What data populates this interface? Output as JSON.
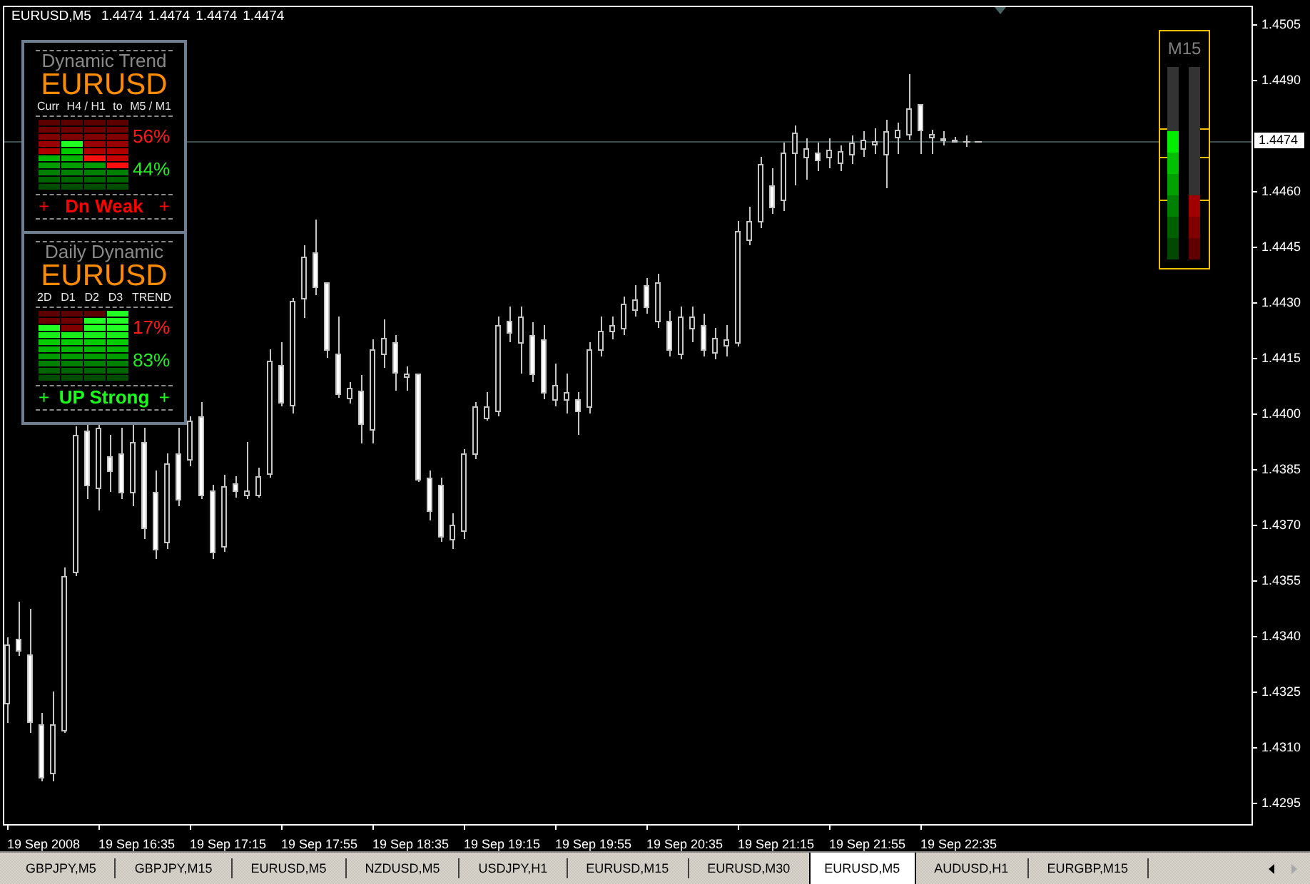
{
  "chart": {
    "symbol": "EURUSD,M5",
    "ohlc": [
      "1.4474",
      "1.4474",
      "1.4474",
      "1.4474"
    ]
  },
  "indicator_panels": [
    {
      "title": "Dynamic Trend",
      "symbol": "EURUSD",
      "column_labels": [
        "Curr",
        "H4 / H1",
        "to",
        "M5 / M1"
      ],
      "columns": [
        {
          "cells": [
            {
              "color": "#5c0000"
            },
            {
              "color": "#6e0000"
            },
            {
              "color": "#800000"
            },
            {
              "color": "#990000"
            },
            {
              "color": "#b00000"
            },
            {
              "color": "#00b400"
            },
            {
              "color": "#009c00"
            },
            {
              "color": "#008000"
            },
            {
              "color": "#006400"
            },
            {
              "color": "#004c00"
            }
          ]
        },
        {
          "cells": [
            {
              "color": "#5c0000"
            },
            {
              "color": "#6e0000"
            },
            {
              "color": "#800000"
            },
            {
              "color": "#22ff22"
            },
            {
              "color": "#00cc00"
            },
            {
              "color": "#00b400"
            },
            {
              "color": "#009c00"
            },
            {
              "color": "#008000"
            },
            {
              "color": "#006400"
            },
            {
              "color": "#004c00"
            }
          ]
        },
        {
          "cells": [
            {
              "color": "#5c0000"
            },
            {
              "color": "#6e0000"
            },
            {
              "color": "#800000"
            },
            {
              "color": "#990000"
            },
            {
              "color": "#b00000"
            },
            {
              "color": "#ff1010"
            },
            {
              "color": "#009c00"
            },
            {
              "color": "#008000"
            },
            {
              "color": "#006400"
            },
            {
              "color": "#004c00"
            }
          ]
        },
        {
          "cells": [
            {
              "color": "#5c0000"
            },
            {
              "color": "#6e0000"
            },
            {
              "color": "#800000"
            },
            {
              "color": "#990000"
            },
            {
              "color": "#b00000"
            },
            {
              "color": "#c80000"
            },
            {
              "color": "#ff1010"
            },
            {
              "color": "#008000"
            },
            {
              "color": "#006400"
            },
            {
              "color": "#004c00"
            }
          ]
        }
      ],
      "readings": [
        {
          "kind": "bear",
          "text": "56%"
        },
        {
          "kind": "bull",
          "text": "44%"
        }
      ],
      "verdict": {
        "bullish": false,
        "lead": "+",
        "text": "Dn Weak",
        "trail": "+"
      }
    },
    {
      "title": "Daily Dynamic",
      "symbol": "EURUSD",
      "column_labels": [
        "2D",
        "D1",
        "D2",
        "D3",
        "TREND"
      ],
      "columns": [
        {
          "cells": [
            {
              "color": "#5c0000"
            },
            {
              "color": "#6e0000"
            },
            {
              "color": "#22ff22"
            },
            {
              "color": "#1aee1a"
            },
            {
              "color": "#00cc00"
            },
            {
              "color": "#00b400"
            },
            {
              "color": "#009c00"
            },
            {
              "color": "#008000"
            },
            {
              "color": "#006400"
            },
            {
              "color": "#004c00"
            }
          ]
        },
        {
          "cells": [
            {
              "color": "#5c0000"
            },
            {
              "color": "#6e0000"
            },
            {
              "color": "#800000"
            },
            {
              "color": "#1aee1a"
            },
            {
              "color": "#00cc00"
            },
            {
              "color": "#00b400"
            },
            {
              "color": "#009c00"
            },
            {
              "color": "#008000"
            },
            {
              "color": "#006400"
            },
            {
              "color": "#004c00"
            }
          ]
        },
        {
          "cells": [
            {
              "color": "#5c0000"
            },
            {
              "color": "#22ff22"
            },
            {
              "color": "#22ff22"
            },
            {
              "color": "#1aee1a"
            },
            {
              "color": "#00cc00"
            },
            {
              "color": "#00b400"
            },
            {
              "color": "#009c00"
            },
            {
              "color": "#008000"
            },
            {
              "color": "#006400"
            },
            {
              "color": "#004c00"
            }
          ]
        },
        {
          "cells": [
            {
              "color": "#22ff22"
            },
            {
              "color": "#22ff22"
            },
            {
              "color": "#22ff22"
            },
            {
              "color": "#1aee1a"
            },
            {
              "color": "#00cc00"
            },
            {
              "color": "#00b400"
            },
            {
              "color": "#009c00"
            },
            {
              "color": "#008000"
            },
            {
              "color": "#006400"
            },
            {
              "color": "#004c00"
            }
          ]
        }
      ],
      "readings": [
        {
          "kind": "bear",
          "text": "17%"
        },
        {
          "kind": "bull",
          "text": "83%"
        }
      ],
      "verdict": {
        "bullish": true,
        "lead": "+",
        "text": "UP Strong",
        "trail": "+"
      }
    }
  ],
  "strength_meter": {
    "label": "M15",
    "bars": [
      {
        "kind": "bull",
        "level": 0.67
      },
      {
        "kind": "bear",
        "level": 0.33
      }
    ]
  },
  "price_axis": {
    "labels": [
      {
        "kind": "tick",
        "text": "1.4505"
      },
      {
        "kind": "tick",
        "text": "1.4490"
      },
      {
        "kind": "current",
        "text": "1.4474"
      },
      {
        "kind": "tick",
        "text": "1.4460"
      },
      {
        "kind": "tick",
        "text": "1.4445"
      },
      {
        "kind": "tick",
        "text": "1.4430"
      },
      {
        "kind": "tick",
        "text": "1.4415"
      },
      {
        "kind": "tick",
        "text": "1.4400"
      },
      {
        "kind": "tick",
        "text": "1.4385"
      },
      {
        "kind": "tick",
        "text": "1.4370"
      },
      {
        "kind": "tick",
        "text": "1.4355"
      },
      {
        "kind": "tick",
        "text": "1.4340"
      },
      {
        "kind": "tick",
        "text": "1.4325"
      },
      {
        "kind": "tick",
        "text": "1.4310"
      },
      {
        "kind": "tick",
        "text": "1.4295"
      }
    ]
  },
  "time_axis": {
    "labels": [
      "19 Sep 2008",
      "19 Sep 16:35",
      "19 Sep 17:15",
      "19 Sep 17:55",
      "19 Sep 18:35",
      "19 Sep 19:15",
      "19 Sep 19:55",
      "19 Sep 20:35",
      "19 Sep 21:15",
      "19 Sep 21:55",
      "19 Sep 22:35"
    ]
  },
  "tabs": [
    {
      "label": "GBPJPY,M5",
      "selected": false
    },
    {
      "label": "GBPJPY,M15",
      "selected": false
    },
    {
      "label": "EURUSD,M5",
      "selected": false
    },
    {
      "label": "NZDUSD,M5",
      "selected": false
    },
    {
      "label": "USDJPY,H1",
      "selected": false
    },
    {
      "label": "EURUSD,M15",
      "selected": false
    },
    {
      "label": "EURUSD,M30",
      "selected": false
    },
    {
      "label": "EURUSD,M5",
      "selected": true
    },
    {
      "label": "AUDUSD,H1",
      "selected": false
    },
    {
      "label": "EURGBP,M15",
      "selected": false
    }
  ],
  "tab_scroll": [
    {
      "kind": "left",
      "disabled": false
    },
    {
      "kind": "right",
      "disabled": true
    }
  ]
}
